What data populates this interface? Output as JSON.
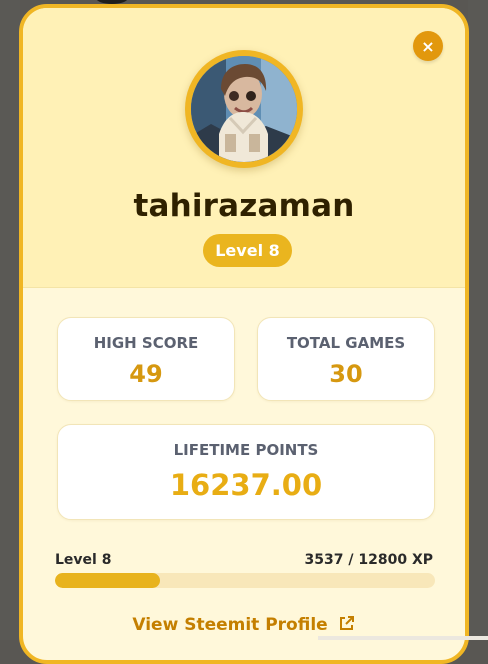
{
  "profile": {
    "username": "tahirazaman",
    "level_badge": "Level 8"
  },
  "stats": {
    "high_score_label": "HIGH SCORE",
    "high_score": "49",
    "total_games_label": "TOTAL GAMES",
    "total_games": "30",
    "lifetime_points_label": "LIFETIME POINTS",
    "lifetime_points": "16237.00"
  },
  "xp": {
    "level_label": "Level 8",
    "progress_text": "3537 / 12800 XP",
    "current": 3537,
    "max": 12800
  },
  "link": {
    "label": "View Steemit Profile"
  },
  "icons": {
    "close": "close-icon",
    "external": "external-link-icon"
  },
  "colors": {
    "accent": "#f0b624",
    "value_text": "#d69810",
    "background": "#fff8da"
  }
}
